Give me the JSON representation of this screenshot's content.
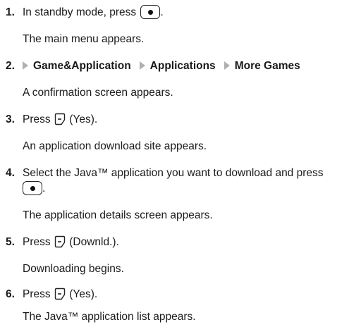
{
  "steps": [
    {
      "num": "1.",
      "before": "In standby mode, press",
      "after": ".",
      "result": "The main menu appears."
    },
    {
      "num": "2.",
      "menu": [
        "Game&Application",
        "Applications",
        "More Games"
      ],
      "result": "A confirmation screen appears."
    },
    {
      "num": "3.",
      "before": "Press",
      "after": "(Yes).",
      "result": "An application download site appears."
    },
    {
      "num": "4.",
      "line1": "Select the Java™ application you want to download and press",
      "after": ".",
      "result": "The application details screen appears."
    },
    {
      "num": "5.",
      "before": "Press",
      "after": "(Downld.).",
      "result": "Downloading begins."
    },
    {
      "num": "6.",
      "before": "Press",
      "after": "(Yes).",
      "result": "The Java™ application list appears."
    }
  ],
  "icons": {
    "center_key": "center-select-key-icon",
    "soft_key": "left-soft-key-icon",
    "menu_arrow": "right-triangle-arrow-icon"
  }
}
